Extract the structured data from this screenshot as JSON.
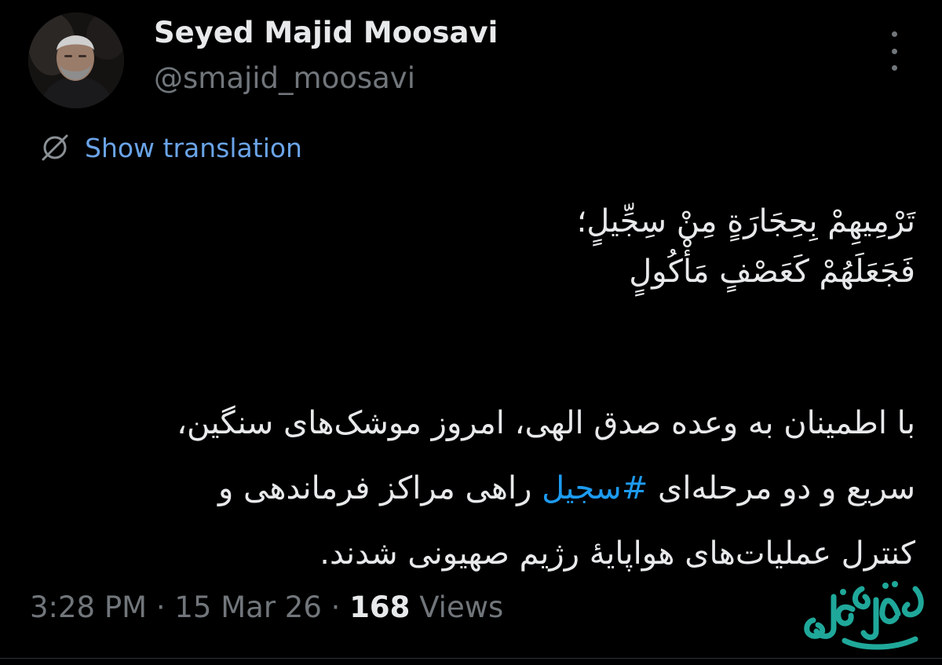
{
  "tweet": {
    "author": {
      "display_name": "Seyed Majid Moosavi",
      "handle": "@smajid_moosavi",
      "avatar_icon": "profile-photo"
    },
    "more_icon": "more-options-vertical-dots-icon",
    "translation": {
      "icon": "translate-globe-icon",
      "label": "Show translation",
      "link_color": "#6aa4e8"
    },
    "verse": [
      "تَرْمِيهِمْ بِحِجَارَةٍ مِنْ سِجِّيلٍ؛",
      "فَجَعَلَهُمْ كَعَصْفٍ مَأْكُولٍ"
    ],
    "paragraph": {
      "line1": "با اطمینان به وعده صدق الهی، امروز موشک‌های سنگین،",
      "line2_before": "سریع و دو مرحله‌ای ",
      "hashtag": "#سجیل",
      "line2_after": " راهی مراکز فرماندهی و",
      "line3": "کنترل عملیات‌های هواپایهٔ رژیم صهیونی شدند."
    },
    "meta": {
      "time": "3:28 PM",
      "separator": "·",
      "date": "15 Mar 26",
      "views_count": "168",
      "views_label": "Views"
    },
    "hashtag_color": "#1d9bf0"
  },
  "watermark": {
    "logo_name": "safhe-eghtesad-logo",
    "text": "صفحه اقتصاد",
    "color": "#1fa89a"
  },
  "theme": {
    "background": "#000000",
    "text_primary": "#e7e9ea",
    "text_secondary": "#71767b"
  }
}
